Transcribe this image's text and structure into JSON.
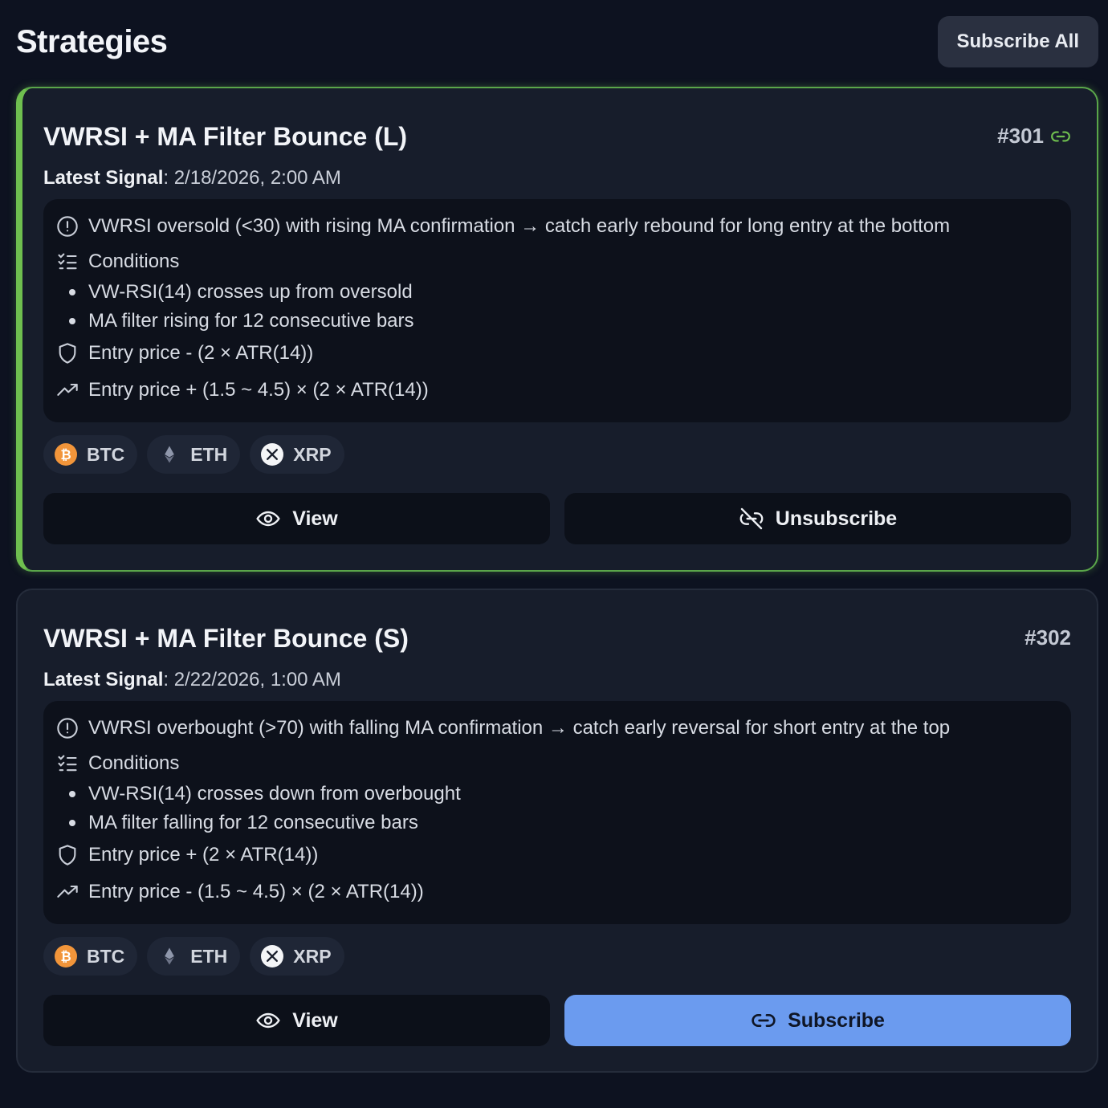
{
  "header": {
    "title": "Strategies",
    "subscribe_all_label": "Subscribe All"
  },
  "strategies": [
    {
      "title": "VWRSI + MA Filter Bounce (L)",
      "id": "#301",
      "subscribed": true,
      "signal_label": "Latest Signal",
      "signal_value": ": 2/18/2026, 2:00 AM",
      "description": "VWRSI oversold (<30) with rising MA confirmation → catch early rebound for long entry at the bottom",
      "conditions_label": "Conditions",
      "conditions": [
        "VW-RSI(14) crosses up from oversold",
        "MA filter rising for 12 consecutive bars"
      ],
      "stop_loss": "Entry price - (2 × ATR(14))",
      "take_profit": "Entry price + (1.5 ~ 4.5) × (2 × ATR(14))",
      "coins": [
        "BTC",
        "ETH",
        "XRP"
      ],
      "view_label": "View",
      "action_label": "Unsubscribe"
    },
    {
      "title": "VWRSI + MA Filter Bounce (S)",
      "id": "#302",
      "subscribed": false,
      "signal_label": "Latest Signal",
      "signal_value": ": 2/22/2026, 1:00 AM",
      "description": "VWRSI overbought (>70) with falling MA confirmation → catch early reversal for short entry at the top",
      "conditions_label": "Conditions",
      "conditions": [
        "VW-RSI(14) crosses down from overbought",
        "MA filter falling for 12 consecutive bars"
      ],
      "stop_loss": "Entry price + (2 × ATR(14))",
      "take_profit": "Entry price - (1.5 ~ 4.5) × (2 × ATR(14))",
      "coins": [
        "BTC",
        "ETH",
        "XRP"
      ],
      "view_label": "View",
      "action_label": "Subscribe"
    }
  ],
  "colors": {
    "active_border": "#6fbf4f",
    "primary_button": "#6b9bef",
    "btc": "#f2953a"
  },
  "icons": [
    "link-icon",
    "info-icon",
    "checklist-icon",
    "shield-icon",
    "trending-up-icon",
    "eye-icon",
    "unlink-icon",
    "btc-icon",
    "eth-icon",
    "xrp-icon"
  ]
}
